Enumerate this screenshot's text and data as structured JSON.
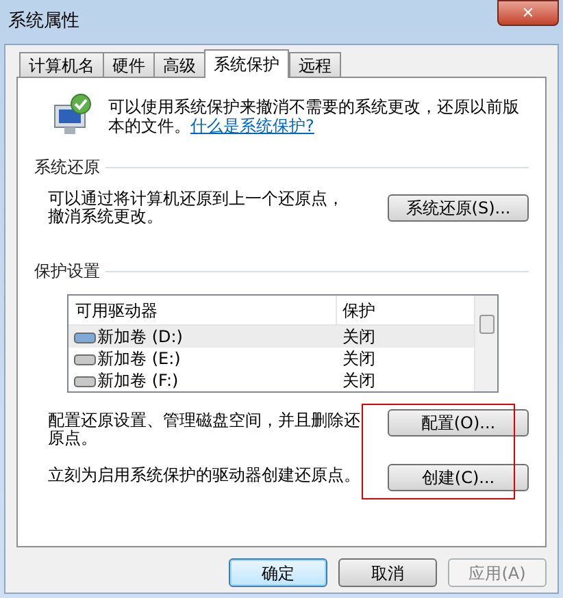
{
  "window": {
    "title": "系统属性",
    "close": "✕"
  },
  "tabs": [
    {
      "label": "计算机名",
      "selected": false
    },
    {
      "label": "硬件",
      "selected": false
    },
    {
      "label": "高级",
      "selected": false
    },
    {
      "label": "系统保护",
      "selected": true
    },
    {
      "label": "远程",
      "selected": false
    }
  ],
  "intro": {
    "text": "可以使用系统保护来撤消不需要的系统更改，还原以前版本的文件。",
    "link": "什么是系统保护?"
  },
  "system_restore": {
    "heading": "系统还原",
    "text": "可以通过将计算机还原到上一个还原点，撤消系统更改。",
    "button": "系统还原(S)..."
  },
  "protection": {
    "heading": "保护设置",
    "columns": [
      "可用驱动器",
      "保护"
    ],
    "rows": [
      {
        "drive": "新加卷 (D:)",
        "protection": "关闭",
        "selected": true
      },
      {
        "drive": "新加卷 (E:)",
        "protection": "关闭",
        "selected": false
      },
      {
        "drive": "新加卷 (F:)",
        "protection": "关闭",
        "selected": false
      }
    ],
    "actions": [
      {
        "text": "配置还原设置、管理磁盘空间，并且删除还原点。",
        "button": "配置(O)..."
      },
      {
        "text": "立刻为启用系统保护的驱动器创建还原点。",
        "button": "创建(C)..."
      }
    ]
  },
  "buttons": [
    {
      "label": "确定",
      "default": true,
      "disabled": false
    },
    {
      "label": "取消",
      "default": false,
      "disabled": false
    },
    {
      "label": "应用(A)",
      "default": false,
      "disabled": true
    }
  ]
}
